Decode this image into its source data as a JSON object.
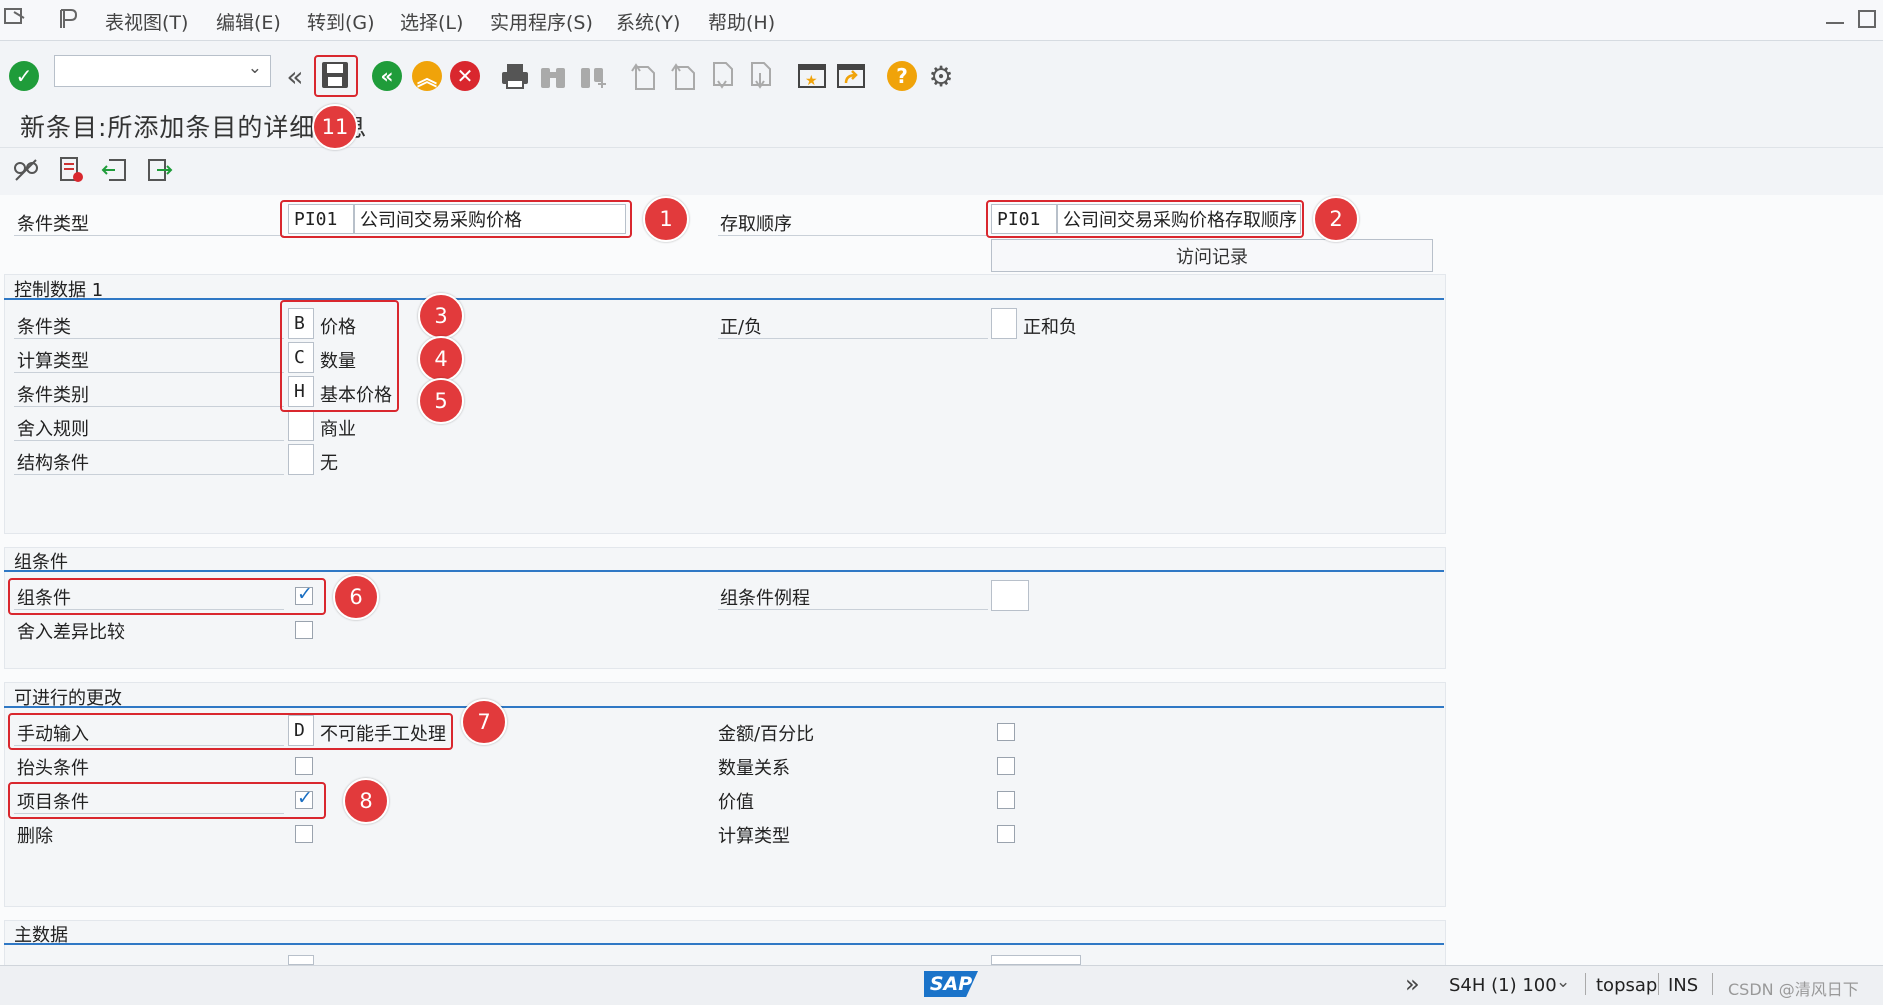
{
  "menu": {
    "items": [
      "表视图(T)",
      "编辑(E)",
      "转到(G)",
      "选择(L)",
      "实用程序(S)",
      "系统(Y)",
      "帮助(H)"
    ]
  },
  "toolbar": {
    "command_value": "",
    "icons": [
      "enter-check-icon",
      "back-double-icon",
      "save-icon",
      "back-icon",
      "exit-icon",
      "cancel-icon",
      "print-icon",
      "find-icon",
      "find-next-icon",
      "first-page-icon",
      "prev-page-icon",
      "next-page-icon",
      "last-page-icon",
      "create-session-icon",
      "shortcut-icon",
      "help-icon",
      "settings-icon"
    ]
  },
  "page": {
    "title": "新条目:所添加条目的详细信息"
  },
  "header_fields": {
    "condition_type_label": "条件类型",
    "condition_type_code": "PI01",
    "condition_type_desc": "公司间交易采购价格",
    "access_sequence_label": "存取顺序",
    "access_sequence_code": "PI01",
    "access_sequence_desc": "公司间交易采购价格存取顺序",
    "access_records_button": "访问记录"
  },
  "control_data": {
    "title": "控制数据 1",
    "cond_class_label": "条件类",
    "cond_class_code": "B",
    "cond_class_desc": "价格",
    "calc_type_label": "计算类型",
    "calc_type_code": "C",
    "calc_type_desc": "数量",
    "cond_category_label": "条件类别",
    "cond_category_code": "H",
    "cond_category_desc": "基本价格",
    "rounding_label": "舍入规则",
    "rounding_code": "",
    "rounding_desc": "商业",
    "struct_label": "结构条件",
    "struct_code": "",
    "struct_desc": "无",
    "plus_minus_label": "正/负",
    "plus_minus_code": "",
    "plus_minus_desc": "正和负"
  },
  "group_condition": {
    "title": "组条件",
    "group_cond_label": "组条件",
    "group_cond_checked": true,
    "rounding_diff_label": "舍入差异比较",
    "rounding_diff_checked": false,
    "routine_label": "组条件例程",
    "routine_value": ""
  },
  "changes": {
    "title": "可进行的更改",
    "manual_label": "手动输入",
    "manual_code": "D",
    "manual_desc": "不可能手工处理",
    "header_cond_label": "抬头条件",
    "header_cond_checked": false,
    "item_cond_label": "项目条件",
    "item_cond_checked": true,
    "delete_label": "删除",
    "delete_checked": false,
    "amount_pct_label": "金额/百分比",
    "amount_pct_checked": false,
    "qty_relation_label": "数量关系",
    "qty_relation_checked": false,
    "value_label": "价值",
    "value_checked": false,
    "calc_type_label": "计算类型",
    "calc_type_checked": false
  },
  "master_data": {
    "title": "主数据"
  },
  "annotations": [
    "1",
    "2",
    "3",
    "4",
    "5",
    "6",
    "7",
    "8",
    "11"
  ],
  "status": {
    "system": "S4H (1) 100",
    "server": "topsap",
    "mode": "INS",
    "watermark": "CSDN @清风日下",
    "logo": "SAP"
  },
  "colors": {
    "accent_blue": "#2f78c5",
    "annotation_red": "#e23a3c",
    "ok_green": "#1f9c3a",
    "warn_orange": "#f0a30a"
  }
}
